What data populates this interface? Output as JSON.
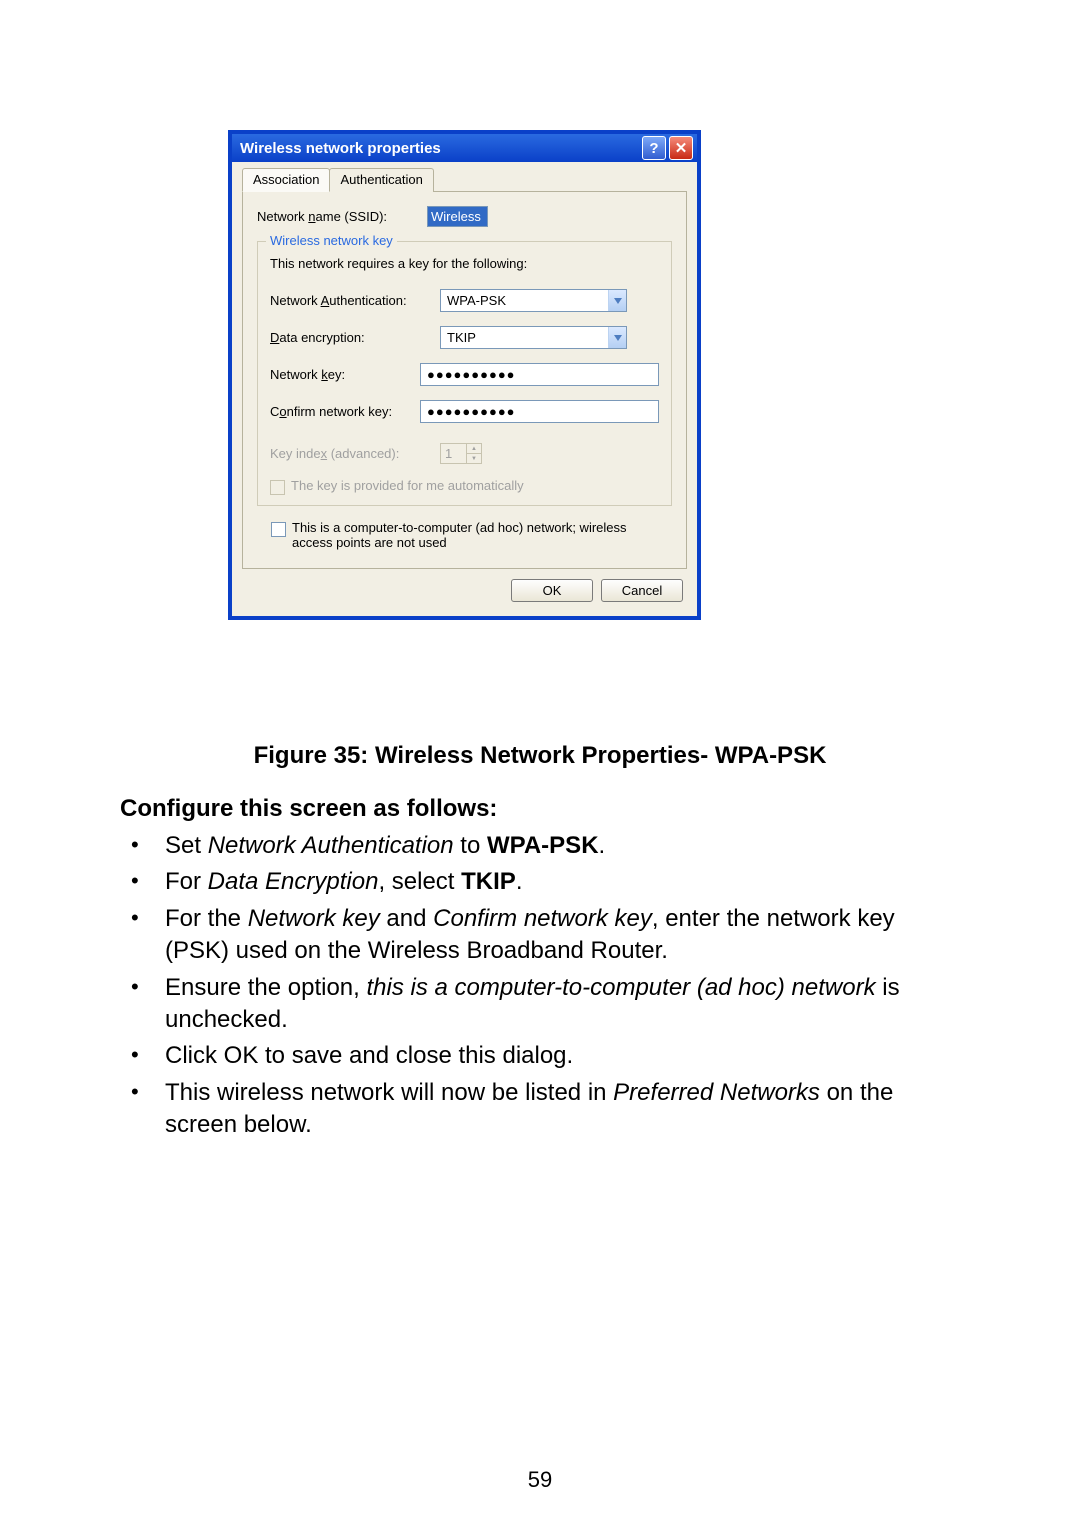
{
  "dialog": {
    "title": "Wireless network properties",
    "tabs": {
      "association": "Association",
      "authentication": "Authentication"
    },
    "ssid_label_pre": "Network ",
    "ssid_label_u": "n",
    "ssid_label_post": "ame (SSID):",
    "ssid_value": "Wireless",
    "group_legend": "Wireless network key",
    "group_desc": "This network requires a key for the following:",
    "auth_label_pre": "Network ",
    "auth_label_u": "A",
    "auth_label_post": "uthentication:",
    "auth_value": "WPA-PSK",
    "enc_label_u": "D",
    "enc_label_post": "ata encryption:",
    "enc_value": "TKIP",
    "key_label_pre": "Network ",
    "key_label_u": "k",
    "key_label_post": "ey:",
    "key_value": "●●●●●●●●●●",
    "confirm_label_pre": "C",
    "confirm_label_u": "o",
    "confirm_label_post": "nfirm network key:",
    "confirm_value": "●●●●●●●●●●",
    "index_label_pre": "Key inde",
    "index_label_u": "x",
    "index_label_post": " (advanced):",
    "index_value": "1",
    "autokey_pre": "T",
    "autokey_u": "h",
    "autokey_post": "e key is provided for me automatically",
    "adhoc_pre": "This is a ",
    "adhoc_u": "c",
    "adhoc_post": "omputer-to-computer (ad hoc) network; wireless access points are not used",
    "ok": "OK",
    "cancel": "Cancel"
  },
  "caption": "Figure 35: Wireless Network Properties- WPA-PSK",
  "heading": "Configure this screen as follows:",
  "bullets": {
    "b1a": "Set ",
    "b1i": "Network Authentication",
    "b1b": " to ",
    "b1c": "WPA-PSK",
    "b1d": ".",
    "b2a": "For ",
    "b2i": "Data Encryption",
    "b2b": ", select ",
    "b2c": "TKIP",
    "b2d": ".",
    "b3a": "For the ",
    "b3i1": "Network key",
    "b3b": " and ",
    "b3i2": "Confirm network key",
    "b3c": ", enter the network key (PSK) used on the Wireless Broadband Router.",
    "b4a": "Ensure the option, ",
    "b4i": "this is a computer-to-computer (ad hoc) network",
    "b4b": " is unchecked.",
    "b5": "Click OK to save and close this dialog.",
    "b6a": "This wireless network will now be listed in ",
    "b6i": "Preferred Networks",
    "b6b": " on the screen below."
  },
  "page_number": "59"
}
